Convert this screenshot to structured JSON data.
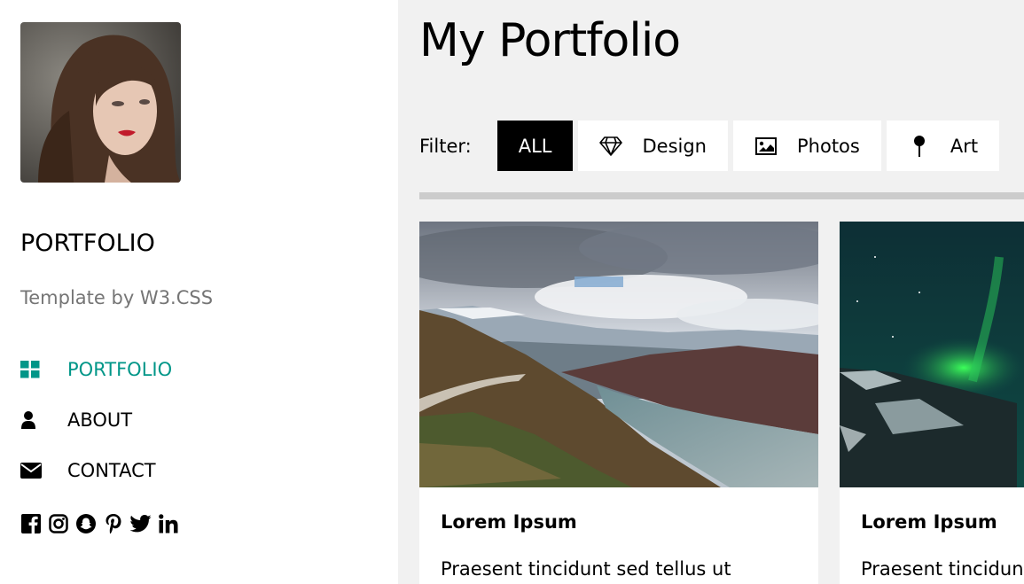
{
  "sidebar": {
    "brand": "PORTFOLIO",
    "tagline": "Template by W3.CSS",
    "nav": [
      {
        "label": "PORTFOLIO",
        "icon": "grid-icon",
        "active": true
      },
      {
        "label": "ABOUT",
        "icon": "user-icon",
        "active": false
      },
      {
        "label": "CONTACT",
        "icon": "envelope-icon",
        "active": false
      }
    ],
    "social": [
      "facebook-icon",
      "instagram-icon",
      "snapchat-icon",
      "pinterest-icon",
      "twitter-icon",
      "linkedin-icon"
    ]
  },
  "main": {
    "title": "My Portfolio",
    "filter_label": "Filter:",
    "filters": [
      {
        "label": "ALL",
        "icon": "",
        "active": true
      },
      {
        "label": "Design",
        "icon": "diamond-icon",
        "active": false
      },
      {
        "label": "Photos",
        "icon": "photo-icon",
        "active": false
      },
      {
        "label": "Art",
        "icon": "map-pin-icon",
        "active": false
      }
    ],
    "cards": [
      {
        "title": "Lorem Ipsum",
        "text": "Praesent tincidunt sed tellus ut",
        "image": "mountain-lake-photo"
      },
      {
        "title": "Lorem Ipsum",
        "text": "Praesent tincidunt sed tellus ut",
        "image": "northern-lights-photo"
      }
    ]
  },
  "colors": {
    "accent": "#009688",
    "tagline": "#757575",
    "page_bg": "#f1f1f1",
    "divider": "#cccccc"
  }
}
